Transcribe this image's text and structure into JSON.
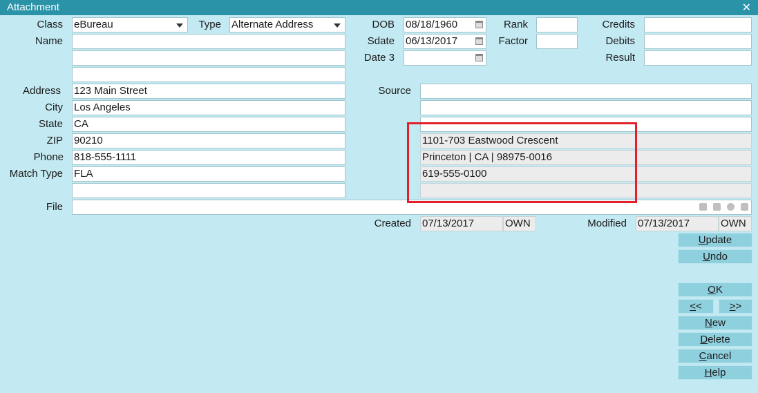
{
  "window": {
    "title": "Attachment",
    "close_glyph": "✕"
  },
  "labels": {
    "class": "Class",
    "type": "Type",
    "name": "Name",
    "address": "Address",
    "city": "City",
    "state": "State",
    "zip": "ZIP",
    "phone": "Phone",
    "match_type": "Match Type",
    "file": "File",
    "dob": "DOB",
    "sdate": "Sdate",
    "date3": "Date 3",
    "rank": "Rank",
    "factor": "Factor",
    "credits": "Credits",
    "debits": "Debits",
    "result": "Result",
    "source": "Source",
    "created": "Created",
    "modified": "Modified"
  },
  "values": {
    "class": "eBureau",
    "type": "Alternate Address",
    "name": "",
    "name2": "",
    "name3": "",
    "address": "123 Main Street",
    "city": "Los Angeles",
    "state": "CA",
    "zip": "90210",
    "phone": "818-555-1111",
    "match_type": "FLA",
    "extra": "",
    "file": "",
    "dob": "08/18/1960",
    "sdate": "06/13/2017",
    "date3": "",
    "rank": "",
    "factor": "",
    "credits": "",
    "debits": "",
    "result": "",
    "source": "",
    "source2": "",
    "source3": "",
    "alt_line1": "1101-703 Eastwood Crescent",
    "alt_line2": "Princeton | CA | 98975-0016",
    "alt_line3": "619-555-0100",
    "alt_line4": "",
    "created_date": "07/13/2017",
    "created_by": "OWN",
    "modified_date": "07/13/2017",
    "modified_by": "OWN"
  },
  "buttons": {
    "update": {
      "accel": "U",
      "rest": "pdate"
    },
    "undo": {
      "accel": "U",
      "rest": "ndo"
    },
    "ok": {
      "accel": "O",
      "rest": "K"
    },
    "prev": {
      "accel": "<",
      "rest": "<"
    },
    "next": {
      "accel": ">",
      "rest": ">"
    },
    "new": {
      "accel": "N",
      "rest": "ew"
    },
    "delete": {
      "accel": "D",
      "rest": "elete"
    },
    "cancel": {
      "accel": "C",
      "rest": "ancel"
    },
    "help": {
      "accel": "H",
      "rest": "elp"
    }
  },
  "icons": {
    "calendar": "calendar-icon",
    "folder": "folder-icon",
    "print": "print-icon",
    "clear": "clear-icon",
    "search": "search-icon"
  },
  "colors": {
    "titlebar": "#2a93a8",
    "background": "#c3e9f2",
    "button": "#8fd0de",
    "highlight": "#e1202a"
  }
}
